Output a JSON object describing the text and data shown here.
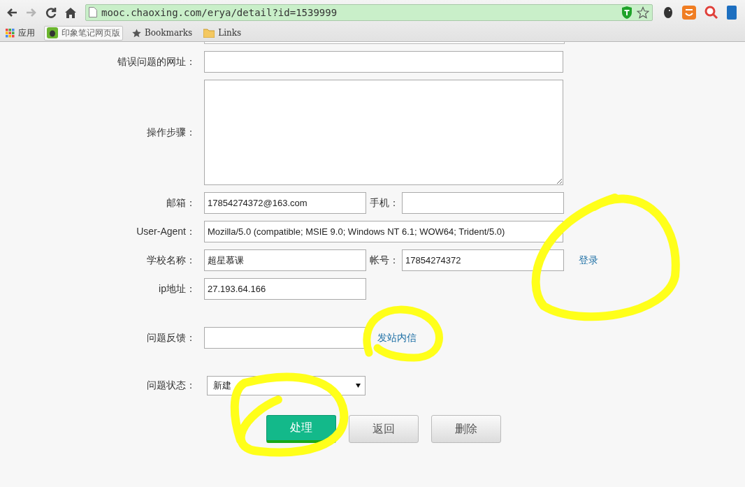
{
  "browser": {
    "nav_buttons": [
      {
        "kind": "back",
        "disabled": false
      },
      {
        "kind": "forward",
        "disabled": true
      },
      {
        "kind": "reload",
        "disabled": false
      },
      {
        "kind": "home",
        "disabled": false
      }
    ],
    "url": "mooc.chaoxing.com/erya/detail?id=1539999",
    "bookmarks": [
      {
        "kind": "apps",
        "label": "应用"
      },
      {
        "kind": "evernote",
        "label": "印象笔记网页版"
      },
      {
        "kind": "star",
        "label": "Bookmarks"
      },
      {
        "kind": "folder",
        "label": "Links"
      }
    ]
  },
  "form": {
    "rows": [
      {
        "kind": "text",
        "label": "错误问题的网址：",
        "wide": true
      },
      {
        "kind": "textarea",
        "label": "操作步骤："
      },
      {
        "kind": "text",
        "label": "邮箱：",
        "value": "17854274372@163.com",
        "extra": {
          "label": "手机："
        }
      },
      {
        "kind": "text",
        "label": "User-Agent：",
        "value": "Mozilla/5.0 (compatible; MSIE 9.0; Windows NT 6.1; WOW64; Trident/5.0)",
        "wide": true
      },
      {
        "kind": "text",
        "label": "学校名称：",
        "value": "超星慕课",
        "extra": {
          "label": "帐号：",
          "value": "17854274372"
        },
        "link": "登录"
      },
      {
        "kind": "text",
        "label": "ip地址：",
        "value": "27.193.64.166"
      },
      {
        "kind": "text",
        "label": "问题反馈：",
        "link": "发站内信",
        "gap": true
      },
      {
        "kind": "select",
        "label": "问题状态：",
        "value": "新建",
        "gap": true
      }
    ],
    "buttons": [
      {
        "kind": "primary",
        "label": "处理"
      },
      {
        "kind": "default",
        "label": "返回"
      },
      {
        "kind": "default",
        "label": "删除"
      }
    ]
  }
}
